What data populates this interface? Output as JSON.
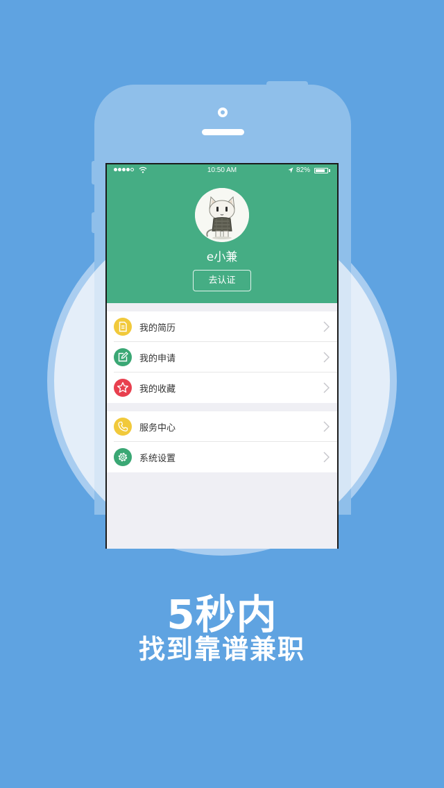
{
  "status_bar": {
    "time": "10:50 AM",
    "battery": "82%"
  },
  "profile": {
    "name": "e小兼",
    "verify_label": "去认证"
  },
  "menu_groups": [
    {
      "items": [
        {
          "label": "我的简历",
          "icon": "resume-icon",
          "color": "#f1c93b"
        },
        {
          "label": "我的申请",
          "icon": "edit-icon",
          "color": "#3aa774"
        },
        {
          "label": "我的收藏",
          "icon": "star-icon",
          "color": "#e8404f"
        }
      ]
    },
    {
      "items": [
        {
          "label": "服务中心",
          "icon": "phone-icon",
          "color": "#f1c93b"
        },
        {
          "label": "系统设置",
          "icon": "gear-icon",
          "color": "#3aa774"
        }
      ]
    }
  ],
  "tagline": {
    "line1": "5秒内",
    "line2": "找到靠谱兼职"
  },
  "colors": {
    "background": "#5fa3e1",
    "header_green": "#45ad84"
  }
}
